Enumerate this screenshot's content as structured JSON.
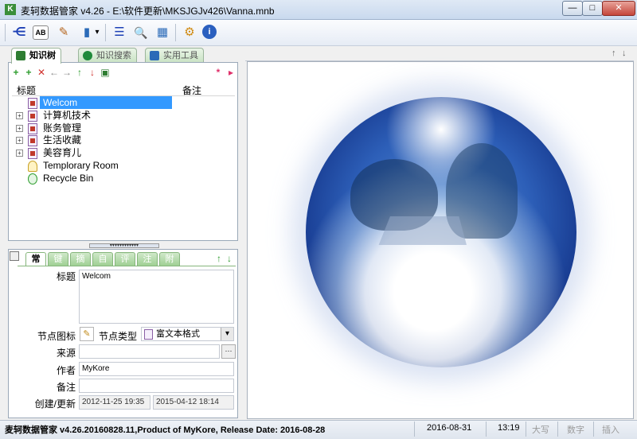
{
  "window": {
    "app_icon": "K",
    "title": "麦轲数据管家 v4.26 - E:\\软件更新\\MKSJGJv426\\Vanna.mnb",
    "minimize": "—",
    "maximize": "□",
    "close": "✕"
  },
  "toolbar": {
    "icons": [
      "tree-toggle-icon",
      "text-ab-icon",
      "edit-note-icon",
      "book-icon",
      "dropdown-icon",
      "outline-icon",
      "search-icon",
      "calendar-table-icon",
      "tools-icon",
      "info-icon"
    ],
    "glyphs": {
      "tree": "⋲",
      "ab": "AB",
      "note": "✎",
      "book": "▮",
      "dropdown": "▾",
      "outline": "☰",
      "search": "🔍",
      "grid": "▦",
      "tools": "⚙",
      "info": "i"
    }
  },
  "left_tabs": [
    {
      "label": "知识树",
      "active": true
    },
    {
      "label": "知识搜索",
      "active": false
    },
    {
      "label": "实用工具",
      "active": false
    }
  ],
  "tree_tools": {
    "add_child": "+",
    "add_sibling": "+",
    "delete": "✕",
    "left": "←",
    "right": "→",
    "up": "↑",
    "down": "↓",
    "save": "▣",
    "star": "*",
    "more": "▸"
  },
  "tree": {
    "col_title": "标题",
    "col_note": "备注",
    "rows": [
      {
        "label": "Welcom",
        "selected": true,
        "expandable": false
      },
      {
        "label": "计算机技术",
        "selected": false,
        "expandable": true
      },
      {
        "label": "账务管理",
        "selected": false,
        "expandable": true
      },
      {
        "label": "生活收藏",
        "selected": false,
        "expandable": true
      },
      {
        "label": "美容育儿",
        "selected": false,
        "expandable": true
      },
      {
        "label": "Templorary Room",
        "selected": false,
        "expandable": false
      },
      {
        "label": "Recycle Bin",
        "selected": false,
        "expandable": false
      }
    ],
    "expand_glyph": "+"
  },
  "splitter_grip": "▾▾▾▾▾▾▾▾▾▾▾▾",
  "prop_tabs": [
    "常",
    "键",
    "摘",
    "自",
    "评",
    "注",
    "附"
  ],
  "prop_arrows": {
    "up": "↑",
    "down": "↓"
  },
  "properties": {
    "title_label": "标题",
    "title_value": "Welcom",
    "node_icon_label": "节点图标",
    "node_type_label": "节点类型",
    "node_type_value": "富文本格式",
    "source_label": "来源",
    "source_value": "",
    "author_label": "作者",
    "author_value": "MyKore",
    "note_label": "备注",
    "note_value": "",
    "created_label": "创建/更新",
    "created_value": "2012-11-25 19:35",
    "updated_value": "2015-04-12 18:14",
    "ellipsis": "···",
    "dropdown": "▾"
  },
  "right_panel": {
    "up": "↑",
    "down": "↓"
  },
  "statusbar": {
    "product": "麦轲数据管家 v4.26.20160828.11,Product of MyKore, Release Date: 2016-08-28",
    "date": "2016-08-31",
    "time": "13:19",
    "caps": "大写",
    "num": "数字",
    "insert": "插入"
  },
  "colors": {
    "selection": "#3399ff",
    "tab_green": "#9fd094",
    "delete_red": "#d0312d"
  }
}
